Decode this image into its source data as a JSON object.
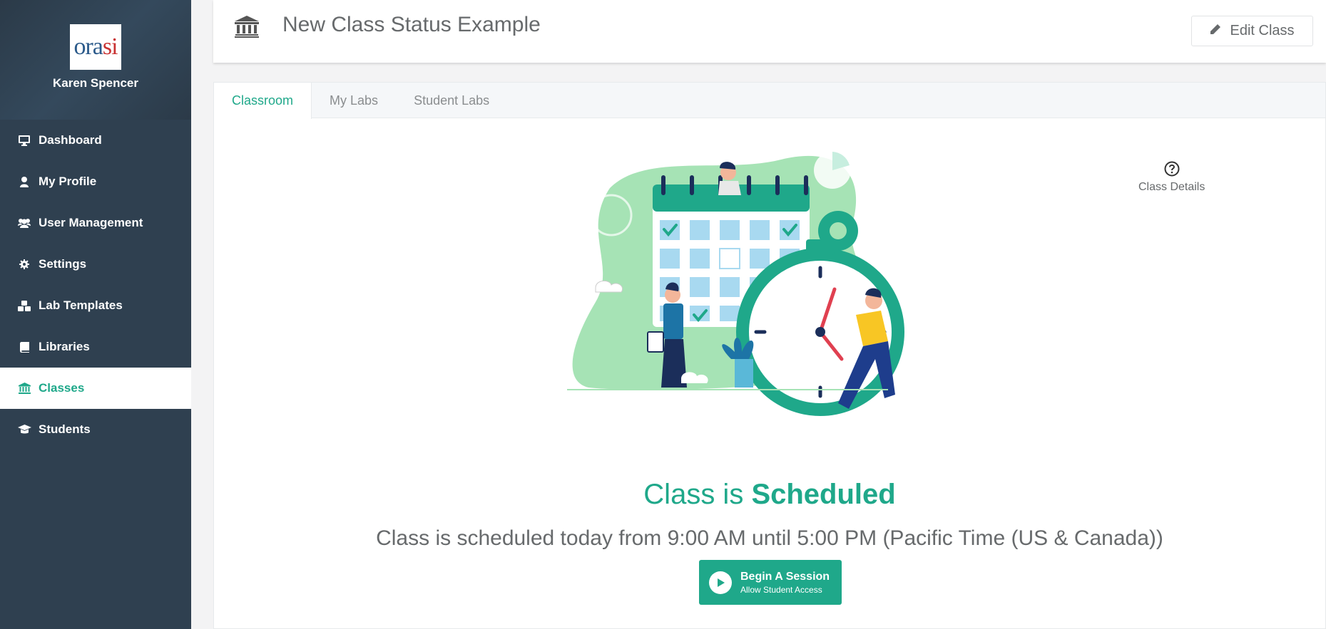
{
  "user": {
    "name": "Karen Spencer",
    "logo_text": "ora",
    "logo_text_accent": "si"
  },
  "sidebar": {
    "items": [
      {
        "label": "Dashboard",
        "icon": "monitor-icon"
      },
      {
        "label": "My Profile",
        "icon": "user-icon"
      },
      {
        "label": "User Management",
        "icon": "users-icon"
      },
      {
        "label": "Settings",
        "icon": "gear-icon"
      },
      {
        "label": "Lab Templates",
        "icon": "cubes-icon"
      },
      {
        "label": "Libraries",
        "icon": "book-icon"
      },
      {
        "label": "Classes",
        "icon": "bank-icon",
        "active": true
      },
      {
        "label": "Students",
        "icon": "graduation-cap-icon"
      }
    ]
  },
  "header": {
    "title": "New Class Status Example",
    "edit_label": "Edit Class"
  },
  "tabs": [
    {
      "label": "Classroom",
      "active": true
    },
    {
      "label": "My Labs"
    },
    {
      "label": "Student Labs"
    }
  ],
  "details_label": "Class Details",
  "status": {
    "prefix": "Class is ",
    "state": "Scheduled"
  },
  "schedule_text": "Class is scheduled today from 9:00 AM until 5:00 PM (Pacific Time (US & Canada))",
  "begin": {
    "title": "Begin A Session",
    "subtitle": "Allow Student Access"
  },
  "colors": {
    "accent": "#1fa88a",
    "sidebar": "#2f4050",
    "text": "#676a6c"
  }
}
